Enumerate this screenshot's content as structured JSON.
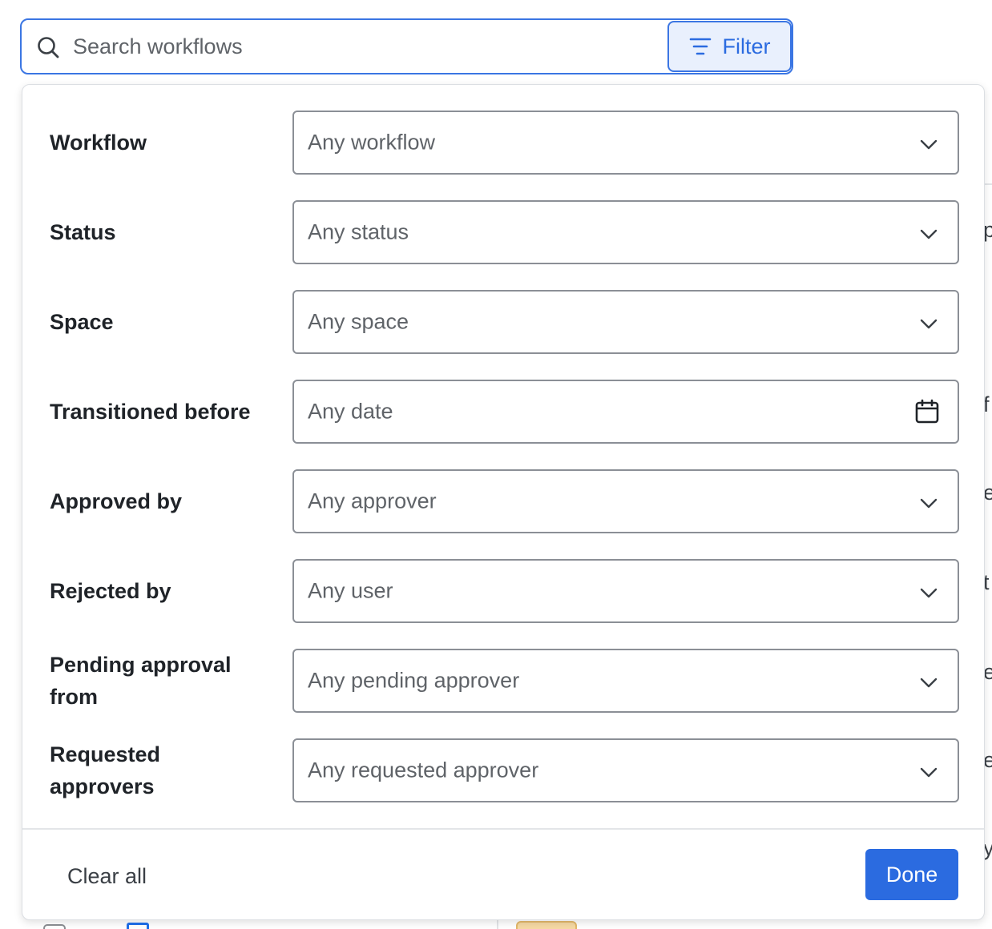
{
  "search": {
    "placeholder": "Search workflows",
    "filter_label": "Filter"
  },
  "filters": {
    "workflow": {
      "label": "Workflow",
      "value": "Any workflow"
    },
    "status": {
      "label": "Status",
      "value": "Any status"
    },
    "space": {
      "label": "Space",
      "value": "Any space"
    },
    "transitioned_before": {
      "label": "Transitioned before",
      "value": "Any date"
    },
    "approved_by": {
      "label": "Approved by",
      "value": "Any approver"
    },
    "rejected_by": {
      "label": "Rejected by",
      "value": "Any user"
    },
    "pending_approval_from": {
      "label": "Pending approval from",
      "value": "Any pending approver"
    },
    "requested_approvers": {
      "label": "Requested approvers",
      "value": "Any requested approver"
    }
  },
  "footer": {
    "clear_all": "Clear all",
    "done": "Done"
  },
  "colors": {
    "accent": "#2b6be0",
    "accent_light": "#e9f0fd",
    "border": "#8b8f96"
  },
  "icons": {
    "search": "search-icon",
    "filter": "filter-icon",
    "dropdown": "chevron-down-icon",
    "date": "calendar-icon"
  }
}
